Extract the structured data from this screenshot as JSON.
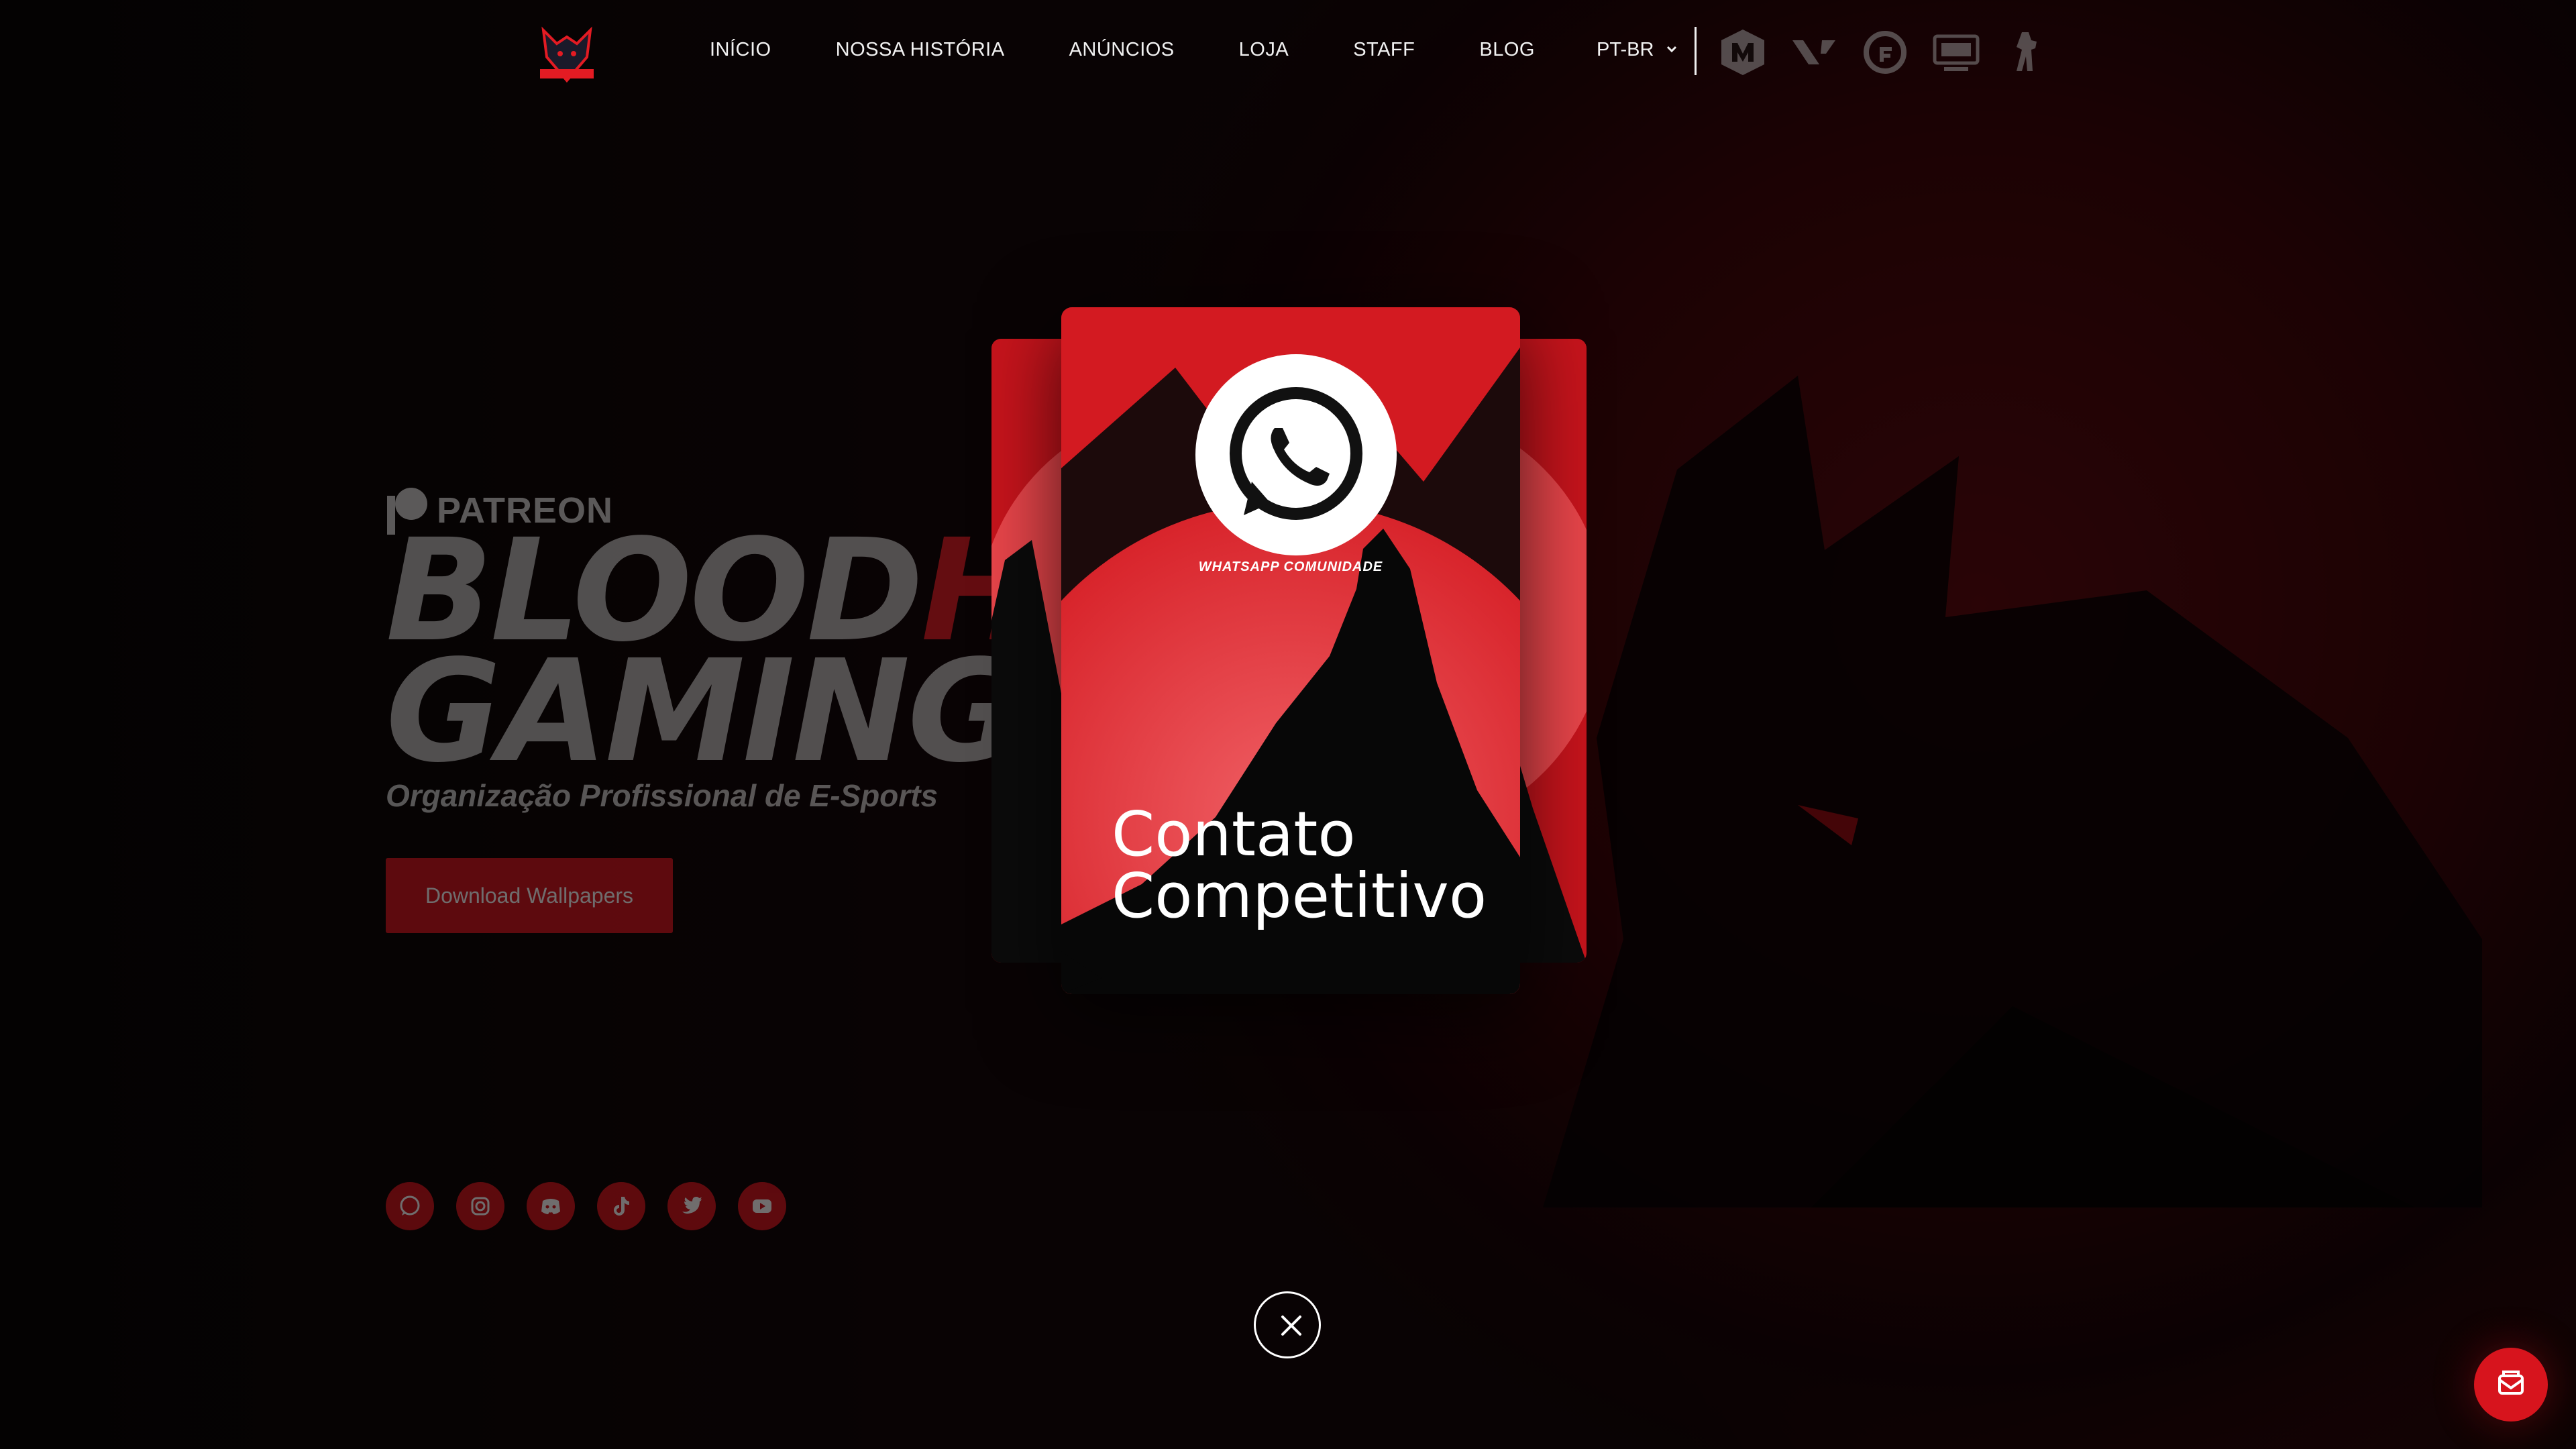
{
  "nav": {
    "logo_icon": "bloodhunts-wolf-logo",
    "items": [
      {
        "label": "INÍCIO"
      },
      {
        "label": "NOSSA HISTÓRIA"
      },
      {
        "label": "ANÚNCIOS"
      },
      {
        "label": "LOJA"
      },
      {
        "label": "STAFF"
      },
      {
        "label": "BLOG"
      }
    ],
    "language": "PT-BR",
    "game_icons": [
      "mobile-legends-icon",
      "valorant-icon",
      "free-fire-icon",
      "pubg-mobile-icon",
      "counter-strike-icon"
    ]
  },
  "hero": {
    "patreon": "PATREON",
    "title_part1": "BLOOD",
    "title_part2": "HU",
    "title_line2": "GAMING",
    "subtitle": "Organização Profissional de E-Sports",
    "download_button": "Download Wallpapers"
  },
  "socials": [
    "whatsapp-icon",
    "instagram-icon",
    "discord-icon",
    "tiktok-icon",
    "twitter-icon",
    "youtube-icon"
  ],
  "modal": {
    "card_caption": "WHATSAPP COMUNIDADE",
    "card_title_line1": "Contato",
    "card_title_line2": "Competitivo",
    "close_icon": "close-icon"
  },
  "colors": {
    "accent": "#d7141d",
    "background": "#0d0708"
  }
}
